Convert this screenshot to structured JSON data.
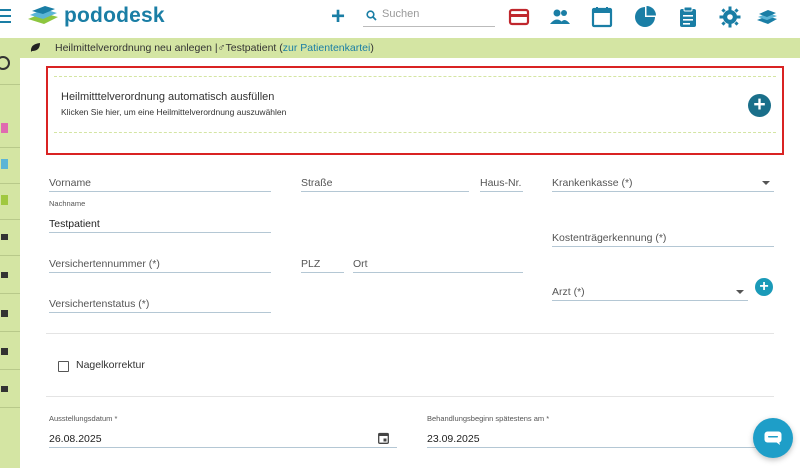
{
  "app": {
    "brand": "pododesk"
  },
  "header": {
    "search_placeholder": "Suchen",
    "icons": [
      "menu-icon",
      "logo",
      "add-icon",
      "search-icon",
      "card-icon",
      "patients-icon",
      "calendar-icon",
      "statistics-icon",
      "clipboard-icon",
      "settings-icon",
      "stack-icon"
    ]
  },
  "breadcrumb": {
    "title": "Heilmittelverordnung neu anlegen |",
    "patient_symbol": "♂",
    "patient": "Testpatient",
    "open_paren": " (",
    "link": "zur Patientenkartei",
    "close_paren": ")"
  },
  "autofill": {
    "title": "Heilmitttelverordnung automatisch ausfüllen",
    "subtitle": "Klicken Sie hier, um eine Heilmittelverordnung auszuwählen"
  },
  "form": {
    "vorname": {
      "placeholder": "Vorname",
      "value": ""
    },
    "strasse": {
      "placeholder": "Straße",
      "value": ""
    },
    "hausnr": {
      "placeholder": "Haus-Nr.",
      "value": ""
    },
    "krankenkasse": {
      "placeholder": "Krankenkasse (*)",
      "value": ""
    },
    "nachname": {
      "label": "Nachname",
      "value": "Testpatient"
    },
    "kostentraeger": {
      "placeholder": "Kostenträgerkennung (*)",
      "value": ""
    },
    "versichertennummer": {
      "placeholder": "Versichertennummer (*)",
      "value": ""
    },
    "plz": {
      "placeholder": "PLZ",
      "value": ""
    },
    "ort": {
      "placeholder": "Ort",
      "value": ""
    },
    "arzt": {
      "placeholder": "Arzt (*)",
      "value": ""
    },
    "versichertenstatus": {
      "placeholder": "Versichertenstatus (*)",
      "value": ""
    },
    "nagelkorrektur": {
      "label": "Nagelkorrektur",
      "checked": false
    },
    "ausstellungsdatum": {
      "label": "Ausstellungsdatum *",
      "value": "26.08.2025"
    },
    "behandlungsbeginn": {
      "label": "Behandlungsbeginn spätestens am *",
      "value": "23.09.2025"
    }
  },
  "colors": {
    "brand": "#1a7ea5",
    "accent_green": "#d4e5a3",
    "highlight_red": "#d92323",
    "card_red": "#c0272d"
  }
}
